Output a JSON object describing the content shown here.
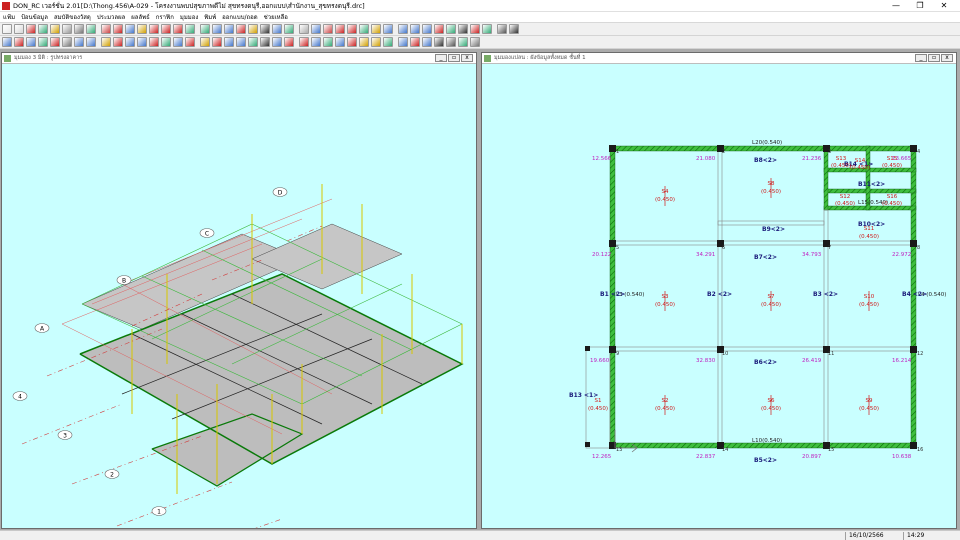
{
  "app": {
    "title": "DON_RC เวอร์ชั่น 2.01[D:\\Thong.456\\A-029 - โครงงานพบปสุขภาพดีไม่ สุขทรงดนุรี,ออกแบบ\\สำนักงาน_สุขทรงดนุรี.drc]",
    "window_controls": [
      "—",
      "❐",
      "✕"
    ]
  },
  "menu": [
    "แฟ้ม",
    "ป้อนข้อมูล",
    "สมบัติของวัสดุ",
    "ประมวลผล",
    "ผลลัพธ์",
    "กราฟิก",
    "มุมมอง",
    "พิมพ์",
    "ออกแบบ/ถอด",
    "ช่วยเหลือ"
  ],
  "left_window": {
    "title": "มุมมอง 3 มิติ : รูปทรงอาคาร",
    "grid_letters": [
      "A",
      "B",
      "C",
      "D"
    ],
    "grid_numbers": [
      "1",
      "2",
      "3",
      "4"
    ]
  },
  "right_window": {
    "title": "มุมมองแปลน : ผังข้อมูลทั้งหมด ชั้นที่ 1",
    "lintels": [
      "L20(0.540)",
      "L10(0.540)",
      "L15(0.540)",
      "L3\n(0.540)",
      "L4\n(0.540)"
    ],
    "beams": [
      "B8<2>",
      "B7<2>",
      "B6<2>",
      "B5<2>",
      "B9<2>",
      "B1\n<2>",
      "B2\n<2>",
      "B3\n<2>",
      "B4\n<2>",
      "B13\n<1>",
      "B14\n<1>",
      "B11<2>",
      "B10<2>"
    ],
    "slabs": [
      {
        "id": "S4",
        "load": "(0.450)"
      },
      {
        "id": "S8",
        "load": "(0.450)"
      },
      {
        "id": "S3",
        "load": "(0.450)"
      },
      {
        "id": "S7",
        "load": "(0.450)"
      },
      {
        "id": "S10",
        "load": "(0.450)"
      },
      {
        "id": "S2",
        "load": "(0.450)"
      },
      {
        "id": "S6",
        "load": "(0.450)"
      },
      {
        "id": "S9",
        "load": "(0.450)"
      },
      {
        "id": "S1",
        "load": "(0.450)"
      },
      {
        "id": "S11",
        "load": "(0.450)"
      },
      {
        "id": "S12",
        "load": "(0.450)"
      },
      {
        "id": "S13",
        "load": "(0.450)"
      },
      {
        "id": "S15",
        "load": "(0.450)"
      },
      {
        "id": "S16",
        "load": "(0.450)"
      },
      {
        "id": "S14",
        "load": "(0.450)"
      }
    ],
    "node_values": [
      "12.566",
      "21.080",
      "21.236",
      "13.665",
      "20.122",
      "34.291",
      "34.793",
      "22.972",
      "19.660",
      "32.830",
      "26.419",
      "16.214",
      "12.265",
      "22.837",
      "20.897",
      "10.638"
    ],
    "node_ids": [
      "1",
      "2",
      "3",
      "4",
      "5",
      "6",
      "7",
      "8",
      "9",
      "10",
      "11",
      "12",
      "13",
      "14",
      "15",
      "16",
      "17",
      "18",
      "19",
      "20",
      "21",
      "22",
      "23",
      "24",
      "25",
      "26",
      "27",
      "28"
    ]
  },
  "status": {
    "date": "16/10/2566",
    "time": "14:29"
  }
}
